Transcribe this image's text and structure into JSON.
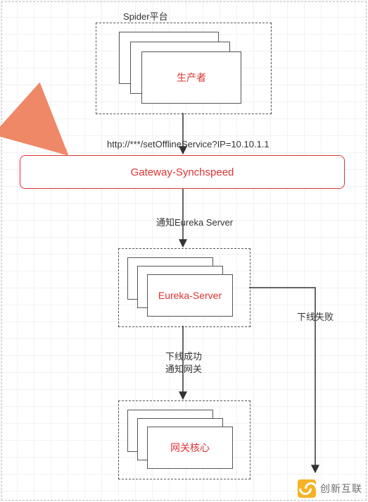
{
  "group": {
    "spider_title": "Spider平台"
  },
  "nodes": {
    "producer": "生产者",
    "synchspeed": "Gateway-Synchspeed",
    "eureka": "Eureka-Server",
    "gateway_core": "网关核心"
  },
  "edges": {
    "http_call": "http://***/setOfflineService?IP=10.10.1.1",
    "notify_eureka": "通知Eureka Server",
    "offline_success": "下线成功\n通知网关",
    "offline_fail": "下线失败"
  },
  "watermark": "创新互联"
}
